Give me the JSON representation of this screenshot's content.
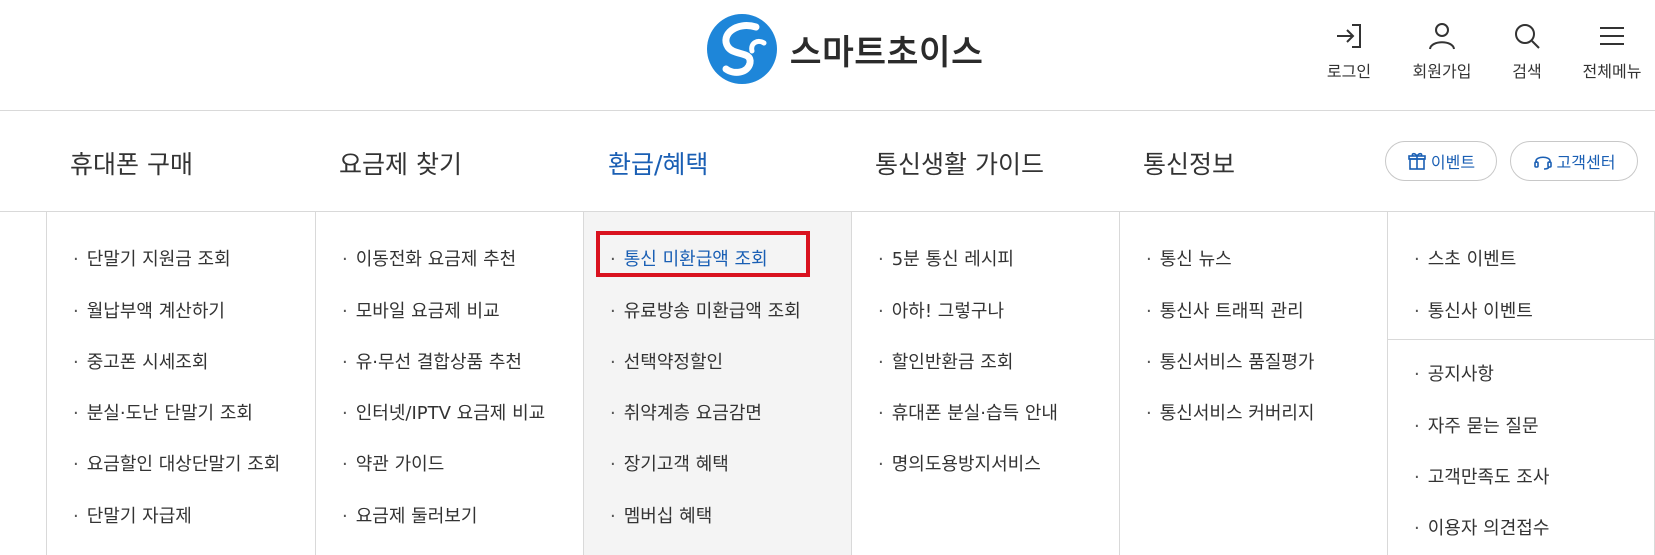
{
  "logo": {
    "text": "스마트초이스",
    "icon": "smartchoice-logo",
    "color": "#1e86d9"
  },
  "util": [
    {
      "label": "로그인",
      "icon": "login-icon"
    },
    {
      "label": "회원가입",
      "icon": "user-icon"
    },
    {
      "label": "검색",
      "icon": "search-icon"
    },
    {
      "label": "전체메뉴",
      "icon": "menu-icon"
    }
  ],
  "gnb": [
    "휴대폰 구매",
    "요금제 찾기",
    "환급/혜택",
    "통신생활 가이드",
    "통신정보"
  ],
  "gnb_active_index": 2,
  "pills": [
    {
      "label": "이벤트",
      "icon": "gift-icon"
    },
    {
      "label": "고객센터",
      "icon": "headset-icon"
    }
  ],
  "columns": [
    [
      "단말기 지원금 조회",
      "월납부액 계산하기",
      "중고폰 시세조회",
      "분실·도난 단말기 조회",
      "요금할인 대상단말기 조회",
      "단말기 자급제"
    ],
    [
      "이동전화 요금제 추천",
      "모바일 요금제 비교",
      "유·무선 결합상품 추천",
      "인터넷/IPTV 요금제 비교",
      "약관 가이드",
      "요금제 둘러보기"
    ],
    [
      "통신 미환급액 조회",
      "유료방송 미환급액 조회",
      "선택약정할인",
      "취약계층 요금감면",
      "장기고객 혜택",
      "멤버십 혜택"
    ],
    [
      "5분 통신 레시피",
      "아하! 그렇구나",
      "할인반환금 조회",
      "휴대폰 분실·습득 안내",
      "명의도용방지서비스"
    ],
    [
      "통신 뉴스",
      "통신사 트래픽 관리",
      "통신서비스 품질평가",
      "통신서비스 커버리지"
    ],
    [
      "스초 이벤트",
      "통신사 이벤트",
      "공지사항",
      "자주 묻는 질문",
      "고객만족도 조사",
      "이용자 의견접수"
    ]
  ],
  "highlighted_item": "통신 미환급액 조회",
  "colors": {
    "accent": "#1a5fb4",
    "highlight_box": "#d9121f",
    "active_column_bg": "#f4f4f4"
  }
}
